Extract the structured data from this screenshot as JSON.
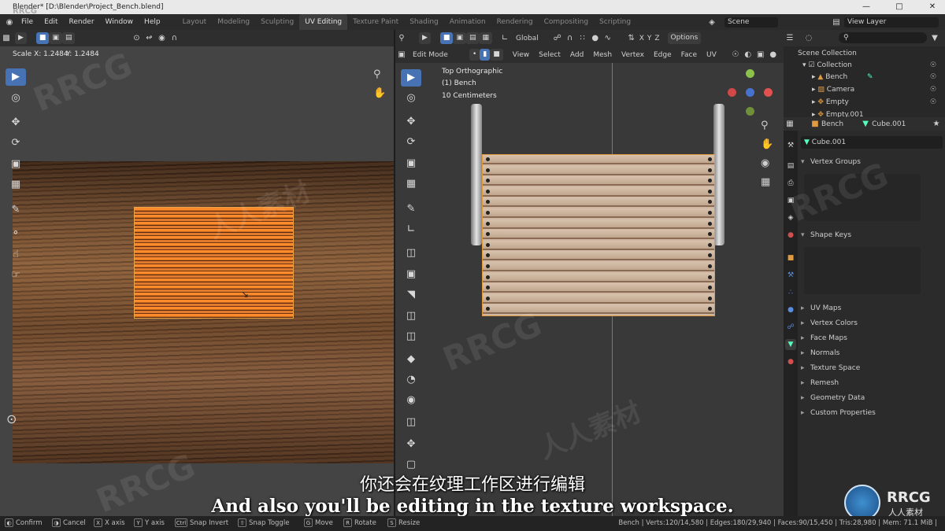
{
  "window": {
    "title": "Blender* [D:\\Blender\\Project_Bench.blend]",
    "watermark_top": "RRCG"
  },
  "menu": [
    "File",
    "Edit",
    "Render",
    "Window",
    "Help"
  ],
  "workspace_tabs": [
    {
      "label": "Layout",
      "active": false
    },
    {
      "label": "Modeling",
      "active": false
    },
    {
      "label": "Sculpting",
      "active": false
    },
    {
      "label": "UV Editing",
      "active": true
    },
    {
      "label": "Texture Paint",
      "active": false
    },
    {
      "label": "Shading",
      "active": false
    },
    {
      "label": "Animation",
      "active": false
    },
    {
      "label": "Rendering",
      "active": false
    },
    {
      "label": "Compositing",
      "active": false
    },
    {
      "label": "Scripting",
      "active": false
    }
  ],
  "scene": {
    "label": "Scene",
    "view_layer": "View Layer"
  },
  "uv_editor": {
    "scale_x": "Scale X: 1.2484",
    "scale_y": "Y: 1.2484"
  },
  "viewport": {
    "orientation": "Global",
    "mode": "Edit Mode",
    "options": "Options",
    "menus": [
      "View",
      "Select",
      "Add",
      "Mesh",
      "Vertex",
      "Edge",
      "Face",
      "UV"
    ],
    "overlay_lines": [
      "Top Orthographic",
      "(1) Bench",
      "10 Centimeters"
    ],
    "axes": [
      "X",
      "Y",
      "Z"
    ]
  },
  "outliner": {
    "root": "Scene Collection",
    "collection": "Collection",
    "items": [
      "Bench",
      "Camera",
      "Empty",
      "Empty.001"
    ]
  },
  "properties": {
    "object": "Bench",
    "mesh": "Cube.001",
    "datablock": "Cube.001",
    "sections": [
      "Vertex Groups",
      "Shape Keys",
      "UV Maps",
      "Vertex Colors",
      "Face Maps",
      "Normals",
      "Texture Space",
      "Remesh",
      "Geometry Data",
      "Custom Properties"
    ]
  },
  "statusbar": {
    "items": [
      {
        "key": "",
        "label": "Confirm"
      },
      {
        "key": "",
        "label": "Cancel"
      },
      {
        "key": "X",
        "label": "X axis"
      },
      {
        "key": "Y",
        "label": "Y axis"
      },
      {
        "key": "Ctrl",
        "label": "Snap Invert"
      },
      {
        "key": "",
        "label": "Snap Toggle"
      },
      {
        "key": "G",
        "label": "Move"
      },
      {
        "key": "R",
        "label": "Rotate"
      },
      {
        "key": "S",
        "label": "Resize"
      }
    ],
    "stats": "Bench | Verts:120/14,580 | Edges:180/29,940 | Faces:90/15,450 | Tris:28,980 | Mem: 71.1 MiB | 2.83.0"
  },
  "subtitles": {
    "cn": "你还会在纹理工作区进行编辑",
    "en": "And also you'll be editing in the texture workspace."
  },
  "brand": {
    "logo_text": "RRCG",
    "logo_sub": "人人素材",
    "watermark": "RRCG",
    "watermark_cn": "人人素材"
  },
  "colors": {
    "accent": "#4772b3",
    "selection": "#e09a40"
  }
}
